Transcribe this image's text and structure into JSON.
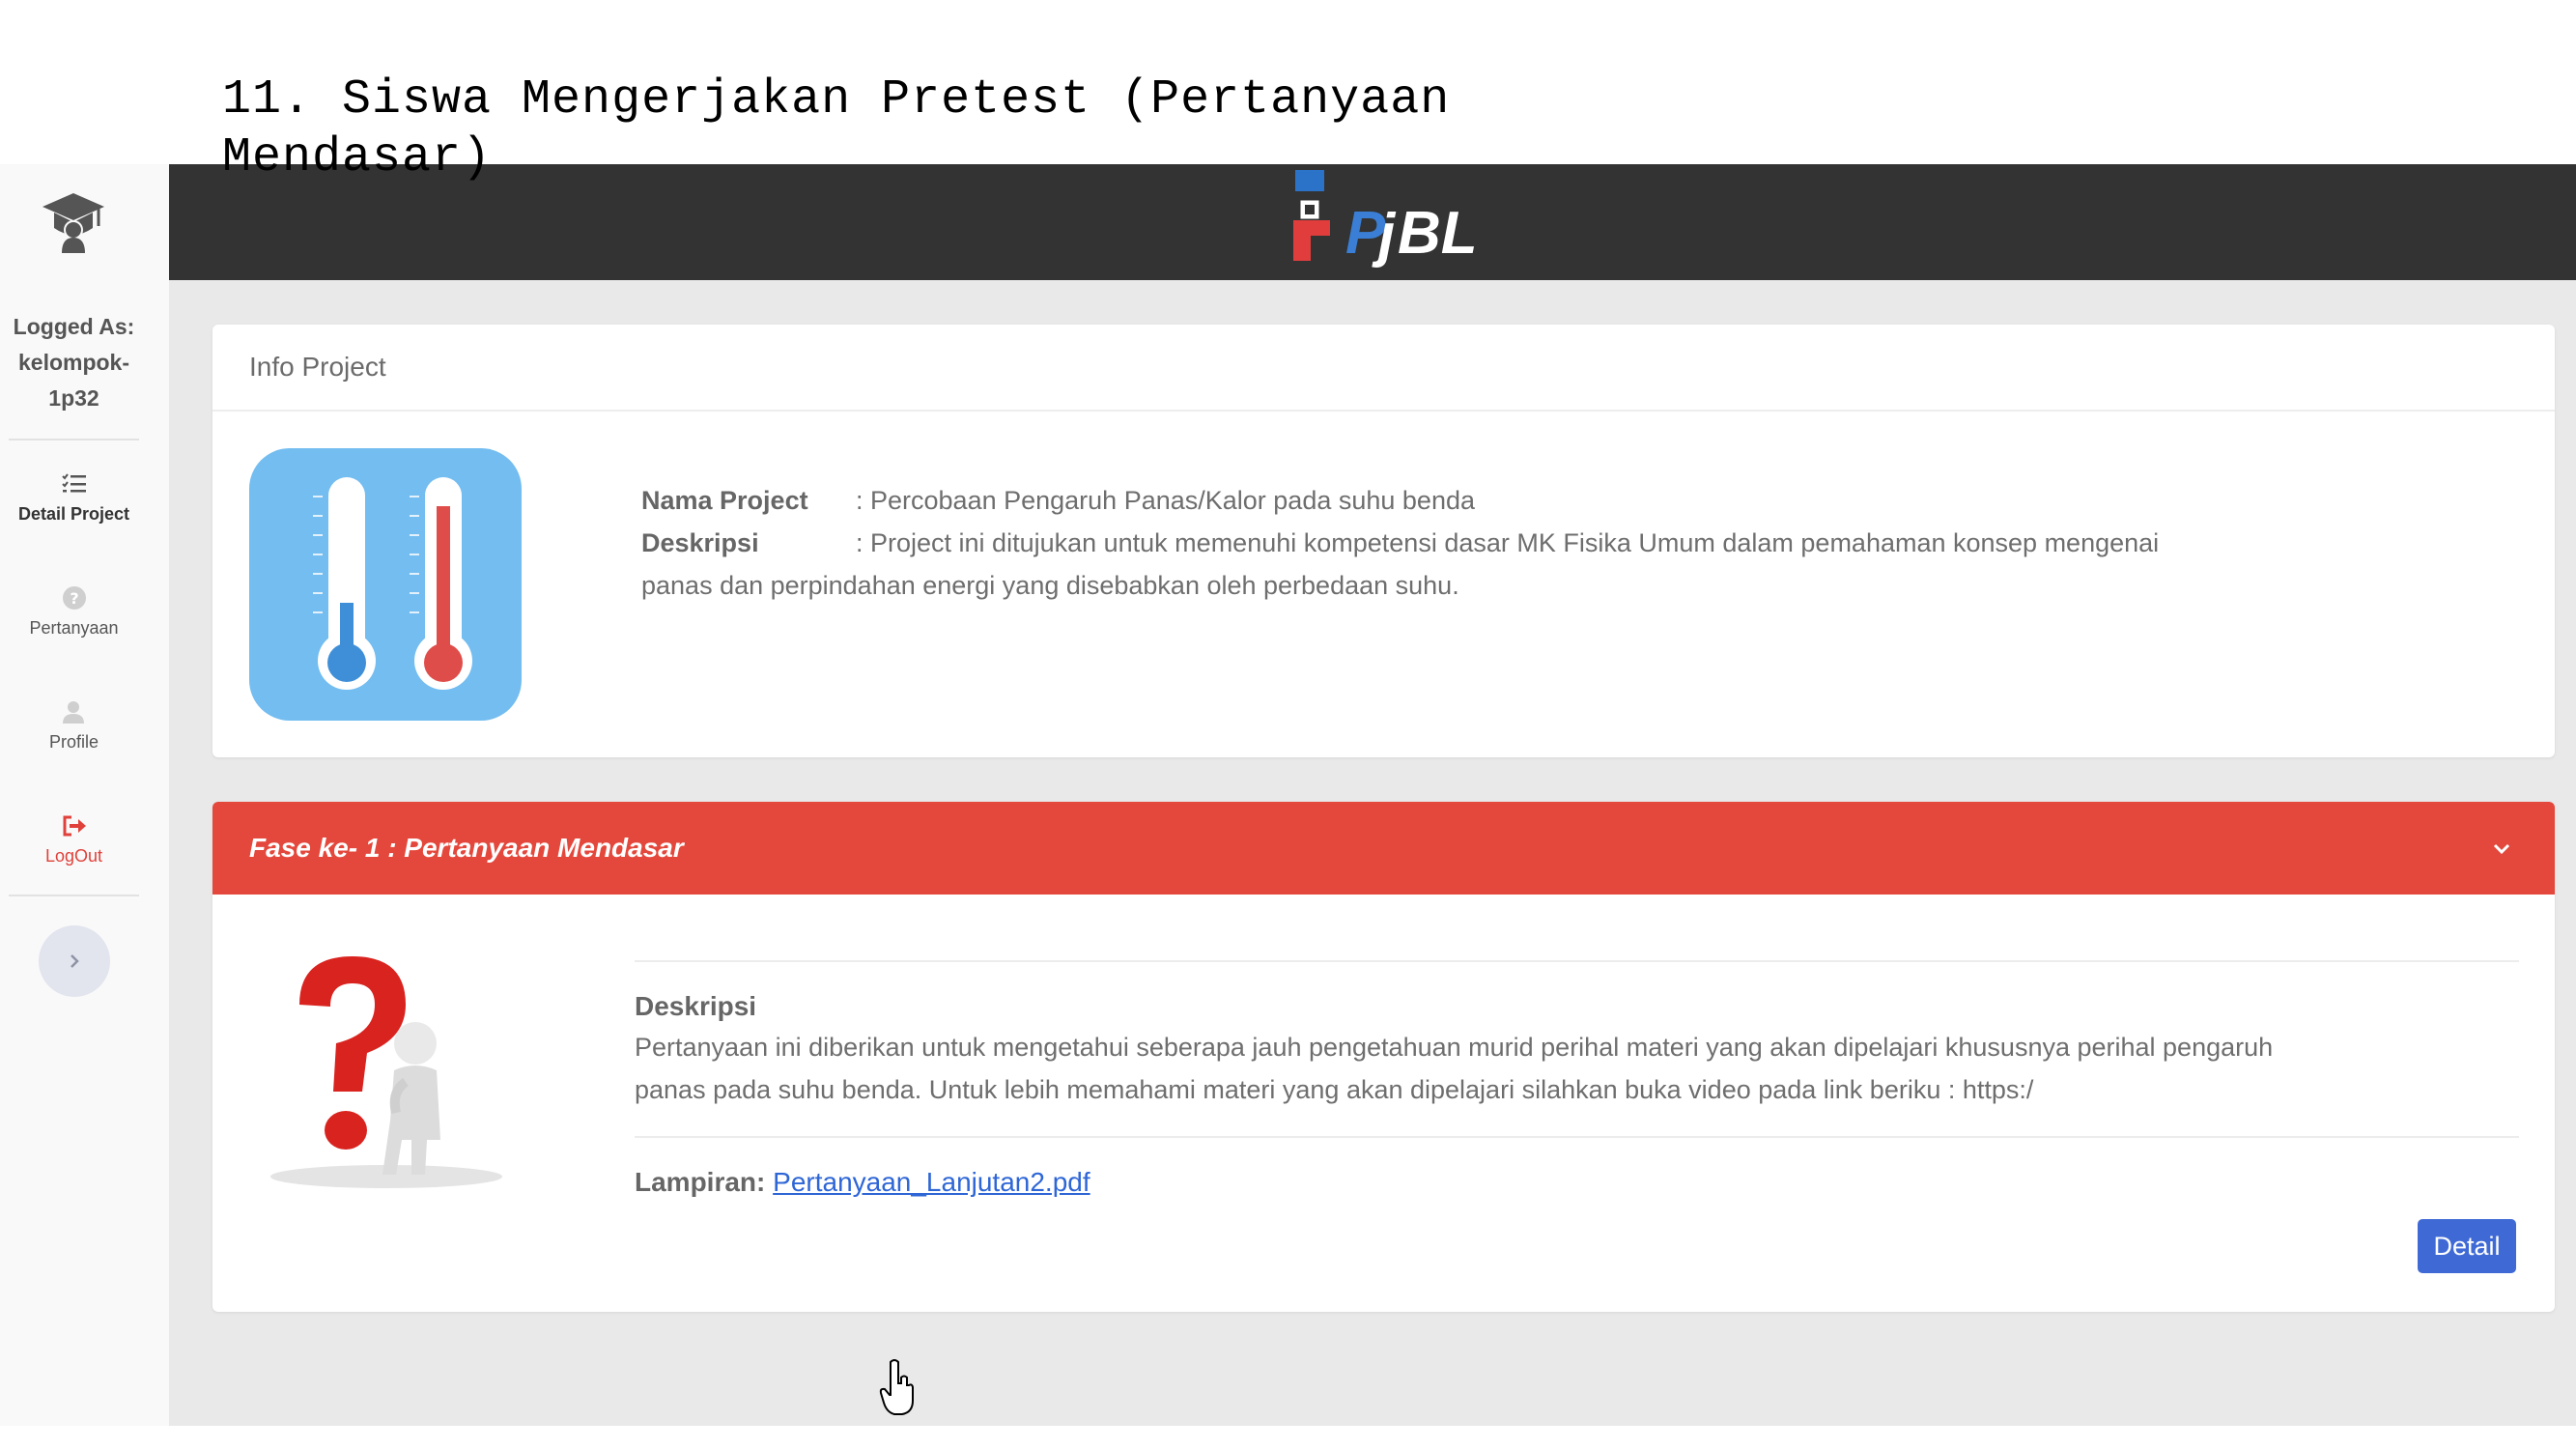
{
  "slide_title": "11. Siswa Mengerjakan Pretest (Pertanyaan Mendasar)",
  "sidebar": {
    "logged_label": "Logged As:",
    "user_line1": "kelompok-",
    "user_line2": "1p32",
    "items": [
      {
        "label": "Detail Project",
        "icon": "list-check-icon"
      },
      {
        "label": "Pertanyaan",
        "icon": "question-circle-icon"
      },
      {
        "label": "Profile",
        "icon": "user-icon"
      },
      {
        "label": "LogOut",
        "icon": "sign-out-icon"
      }
    ],
    "toggle_icon": "chevron-right-icon"
  },
  "brand": {
    "text": "PjBL"
  },
  "info_card": {
    "header": "Info Project",
    "name_label": "Nama Project",
    "name_value": ": Percobaan Pengaruh Panas/Kalor pada suhu benda",
    "desc_label": "Deskripsi",
    "desc_value": ": Project ini ditujukan untuk memenuhi kompetensi dasar MK Fisika Umum dalam pemahaman konsep mengenai",
    "desc_cont": "panas dan perpindahan energi yang disebabkan oleh perbedaan suhu."
  },
  "fase_card": {
    "header": "Fase ke- 1 : Pertanyaan Mendasar",
    "desc_title": "Deskripsi",
    "desc_line1": "Pertanyaan ini diberikan untuk mengetahui seberapa jauh pengetahuan murid perihal materi yang akan dipelajari khususnya perihal pengaruh",
    "desc_line2": "panas pada suhu benda. Untuk lebih memahami materi yang akan dipelajari silahkan buka video pada link beriku : https:/",
    "attachment_label": "Lampiran:",
    "attachment_link": "Pertanyaan_Lanjutan2.pdf",
    "detail_button": "Detail"
  },
  "colors": {
    "topbar": "#333333",
    "fase_header": "#e4473b",
    "button": "#3f6ad6",
    "link": "#2e66d6"
  }
}
